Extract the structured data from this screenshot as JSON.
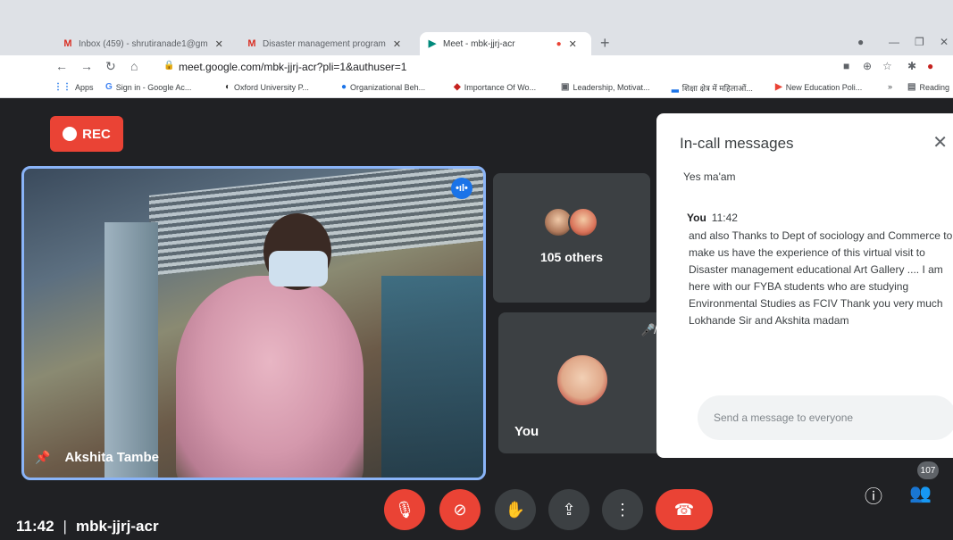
{
  "browser": {
    "tabs": [
      {
        "label": "Inbox (459) - shrutiranade1@gm",
        "icon": "M"
      },
      {
        "label": "Disaster management program",
        "icon": "M"
      },
      {
        "label": "Meet - mbk-jjrj-acr",
        "icon": "▶"
      }
    ],
    "close_glyph": "✕",
    "new_tab_glyph": "+",
    "url": "meet.google.com/mbk-jjrj-acr?pli=1&authuser=1",
    "bookmarks": [
      {
        "label": "Apps",
        "icon": "⋮⋮"
      },
      {
        "label": "Sign in - Google Ac...",
        "icon": "G"
      },
      {
        "label": "Oxford University P...",
        "icon": "◐"
      },
      {
        "label": "Organizational Beh...",
        "icon": "●"
      },
      {
        "label": "Importance Of Wo...",
        "icon": "◆"
      },
      {
        "label": "Leadership, Motivat...",
        "icon": "▣"
      },
      {
        "label": "शिक्षा क्षेत्र में महिलाओं...",
        "icon": "▂"
      },
      {
        "label": "New Education Poli...",
        "icon": "▶"
      },
      {
        "label": "Reading",
        "icon": "▤"
      }
    ]
  },
  "meet": {
    "rec_label": "REC",
    "main_participant": "Akshita Tambe",
    "others_label": "105 others",
    "you_label": "You",
    "chat": {
      "title": "In-call messages",
      "first_message": "Yes ma'am",
      "sender": "You",
      "time": "11:42",
      "message": "and also Thanks to Dept of sociology and Commerce to make us have the experience of this virtual visit to Disaster management educational Art Gallery .... I am here with our FYBA students who are studying Environmental Studies as FCIV Thank you very much Lokhande Sir and Akshita madam",
      "input_placeholder": "Send a message to everyone"
    },
    "clock": "11:42",
    "separator": "|",
    "meeting_code": "mbk-jjrj-acr",
    "participant_count": "107"
  },
  "colors": {
    "accent_red": "#ea4335",
    "active_border": "#8ab4f8",
    "dark_bg": "#202124"
  }
}
